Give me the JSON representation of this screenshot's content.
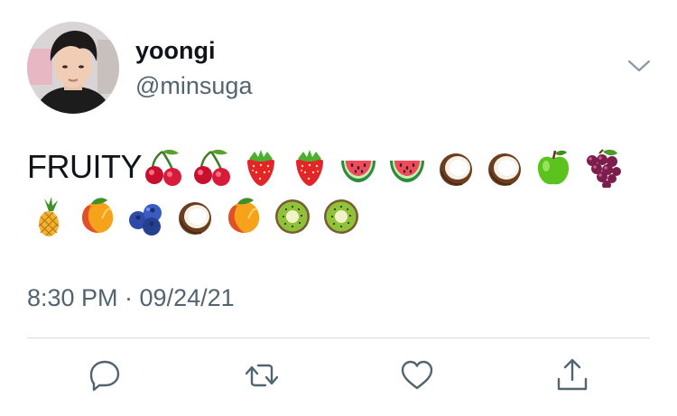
{
  "tweet": {
    "display_name": "yoongi",
    "handle": "@minsuga",
    "text": "FRUITY",
    "emojis_line1": [
      "cherries",
      "cherries",
      "strawberry",
      "strawberry",
      "watermelon",
      "watermelon",
      "coconut",
      "coconut",
      "green-apple",
      "grapes"
    ],
    "emojis_line2": [
      "pineapple",
      "mango",
      "blueberries",
      "coconut",
      "mango",
      "kiwi",
      "kiwi"
    ],
    "timestamp": "8:30 PM · 09/24/21"
  },
  "actions": [
    "reply-icon",
    "retweet-icon",
    "like-icon",
    "share-icon"
  ],
  "colors": {
    "text": "#0f1419",
    "secondary": "#536471",
    "divider": "#d5dbe0"
  }
}
